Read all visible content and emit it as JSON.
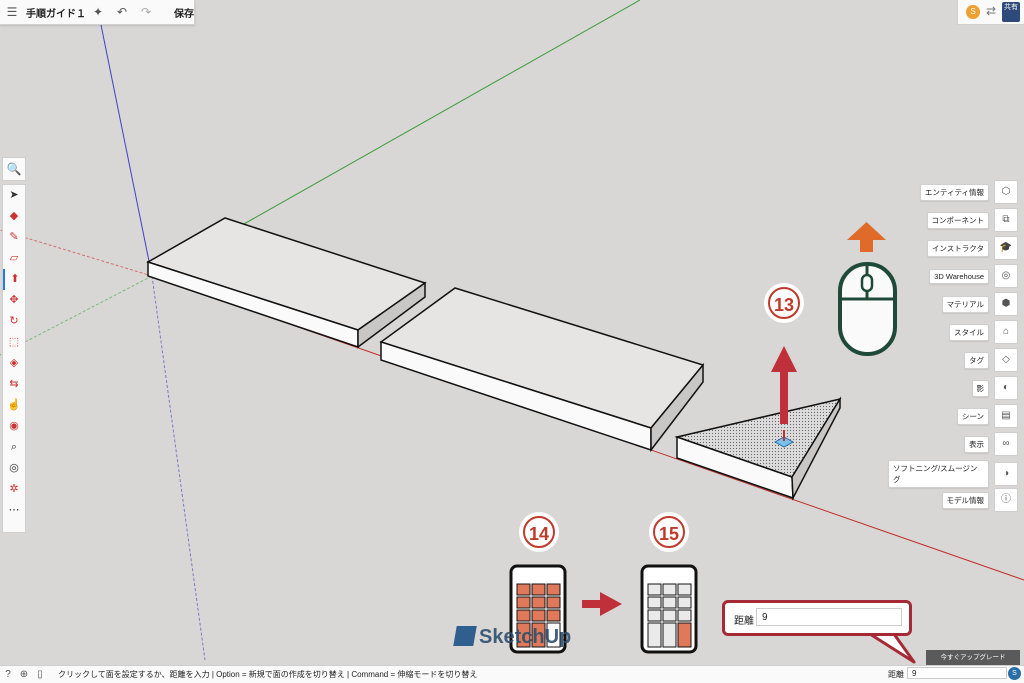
{
  "header": {
    "title": "手順ガイド１",
    "save_label": "保存"
  },
  "topright": {
    "avatar": "S",
    "share_label": "共有"
  },
  "right_panel": {
    "items": [
      {
        "label": "エンティティ情報",
        "icon": "entity-info-icon"
      },
      {
        "label": "コンポーネント",
        "icon": "components-icon"
      },
      {
        "label": "インストラクタ",
        "icon": "instructor-icon"
      },
      {
        "label": "3D Warehouse",
        "icon": "warehouse-icon"
      },
      {
        "label": "マテリアル",
        "icon": "materials-icon"
      },
      {
        "label": "スタイル",
        "icon": "styles-icon"
      },
      {
        "label": "タグ",
        "icon": "tags-icon"
      },
      {
        "label": "影",
        "icon": "shadows-icon"
      },
      {
        "label": "シーン",
        "icon": "scenes-icon"
      },
      {
        "label": "表示",
        "icon": "display-icon"
      },
      {
        "label": "ソフトニング/スムージング",
        "icon": "soften-icon"
      },
      {
        "label": "モデル情報",
        "icon": "model-info-icon"
      }
    ]
  },
  "status": {
    "text": "クリックして面を設定するか、距離を入力 | Option = 新規で面の作成を切り替え | Command = 伸縮モードを切り替え",
    "distance_label": "距離",
    "distance_value": "9"
  },
  "upgrade_label": "今すぐアップグレード",
  "callout": {
    "label": "距離",
    "value": "9"
  },
  "steps": {
    "s13": "13",
    "s14": "14",
    "s15": "15"
  },
  "watermark": "SketchUp",
  "colors": {
    "accent_red": "#c0392b",
    "callout_border": "#a52a35",
    "mouse_green": "#1f4a3a",
    "arrow_orange": "#e06a2a"
  }
}
